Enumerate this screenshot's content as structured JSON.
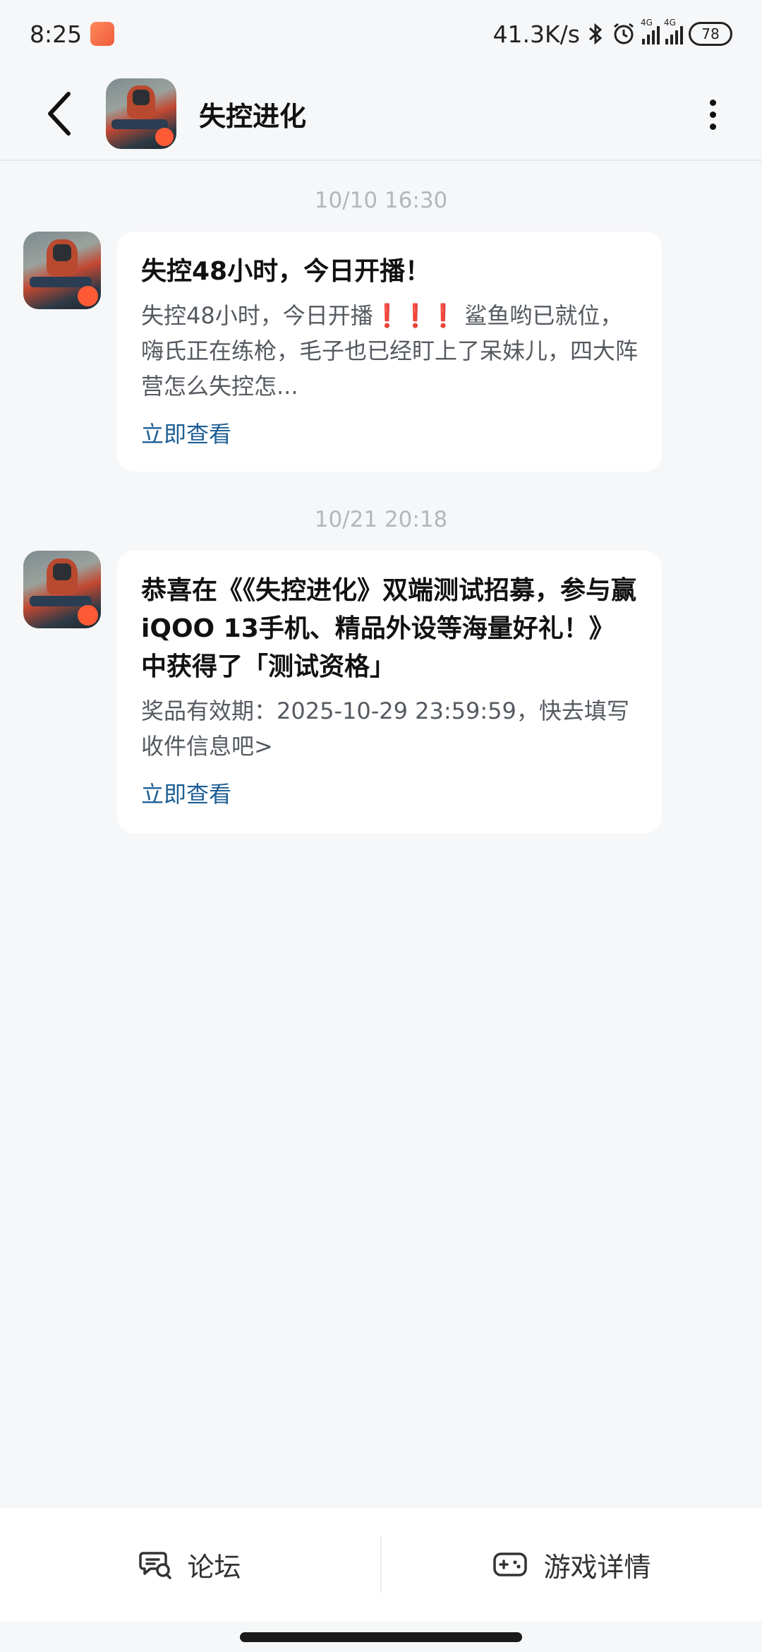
{
  "status_bar": {
    "time": "8:25",
    "net_speed": "41.3K/s",
    "signal_tag_1": "4G",
    "signal_tag_2": "4G",
    "battery": "78"
  },
  "header": {
    "title": "失控进化"
  },
  "messages": [
    {
      "timestamp": "10/10  16:30",
      "title": "失控48小时，今日开播！",
      "body": "失控48小时，今日开播❗❗❗ 鲨鱼哟已就位，嗨氏正在练枪，毛子也已经盯上了呆妹儿，四大阵营怎么失控怎...",
      "link": "立即查看"
    },
    {
      "timestamp": "10/21  20:18",
      "title": "恭喜在《《失控进化》双端测试招募，参与赢iQOO 13手机、精品外设等海量好礼！》中获得了「测试资格」",
      "body": "奖品有效期：2025-10-29 23:59:59，快去填写收件信息吧>",
      "link": "立即查看"
    }
  ],
  "bottom_bar": {
    "forum_label": "论坛",
    "game_detail_label": "游戏详情"
  }
}
